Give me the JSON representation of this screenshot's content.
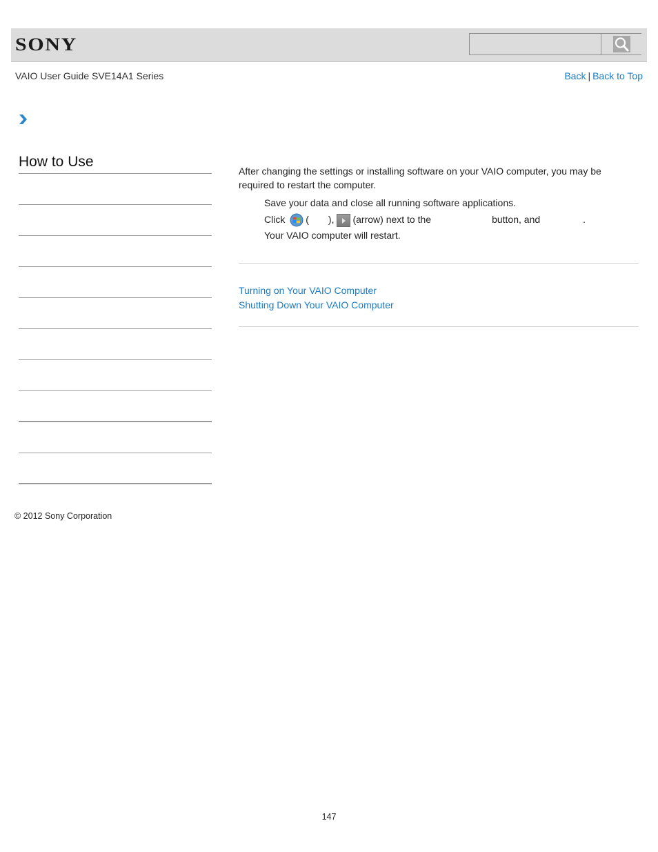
{
  "header": {
    "brand": "SONY",
    "search": {
      "value": "",
      "placeholder": "",
      "button_icon": "search-icon"
    }
  },
  "nav": {
    "guide_title": "VAIO User Guide SVE14A1 Series",
    "back_label": "Back",
    "separator": "|",
    "back_to_top_label": "Back to Top",
    "breadcrumb_icon": "chevron-right-icon",
    "link_color": "#1a7bc7"
  },
  "sidebar": {
    "title": "How to Use",
    "items": [
      {
        "label": ""
      },
      {
        "label": ""
      },
      {
        "label": ""
      },
      {
        "label": ""
      },
      {
        "label": ""
      },
      {
        "label": ""
      },
      {
        "label": ""
      },
      {
        "label": ""
      },
      {
        "label": ""
      },
      {
        "label": ""
      }
    ]
  },
  "content": {
    "intro": "After changing the settings or installing software on your VAIO computer, you may be required to restart the computer.",
    "step1": "Save your data and close all running software applications.",
    "step2": {
      "click": "Click",
      "start_icon": "windows-start-icon",
      "open_paren": "(",
      "close_paren_comma": "),",
      "arrow_icon": "arrow-button-icon",
      "arrow_text": "(arrow) next to the",
      "button_and": "button, and",
      "period": "."
    },
    "result": "Your VAIO computer will restart.",
    "related_links": [
      "Turning on Your VAIO Computer",
      "Shutting Down Your VAIO Computer"
    ]
  },
  "footer": {
    "copyright": "© 2012 Sony Corporation",
    "page_number": "147"
  }
}
